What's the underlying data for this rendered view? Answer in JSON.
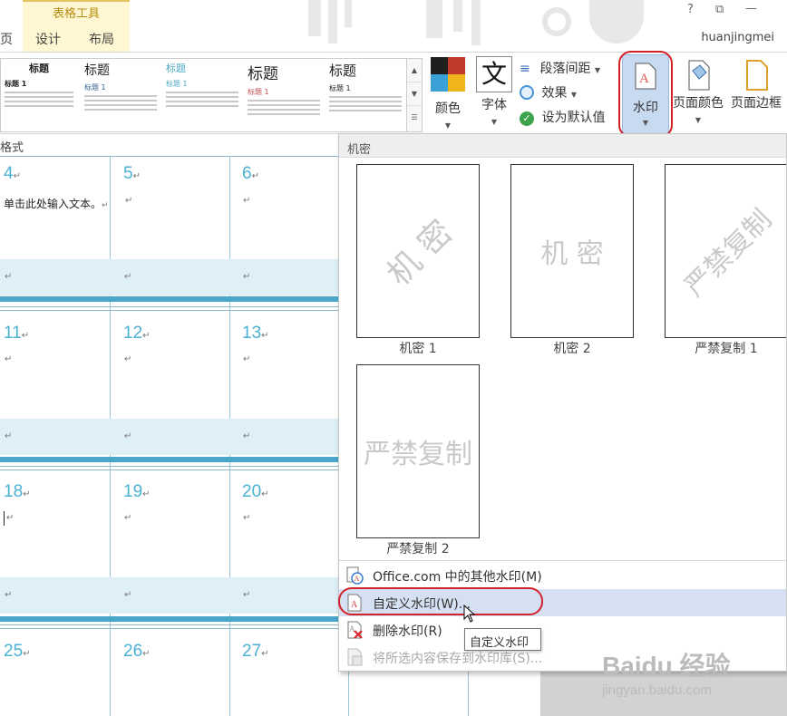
{
  "title_bar": {
    "context_group": "表格工具",
    "tabs": [
      "页",
      "设计",
      "布局"
    ],
    "help": "?",
    "restore": "⧉",
    "minimize": "—",
    "user": "huanjingmei"
  },
  "ribbon": {
    "gallery_styles": [
      {
        "title": "标题",
        "sub": "标题 1"
      },
      {
        "title": "标题",
        "sub": "标题 1"
      },
      {
        "title": "标题",
        "sub": "标题 1"
      },
      {
        "title": "标题",
        "sub": "标题 1"
      },
      {
        "title": "标题",
        "sub": "标题 1"
      }
    ],
    "colors_label": "颜色",
    "fonts_glyph": "文",
    "fonts_label": "字体",
    "paragraph_spacing": "段落间距",
    "effects": "效果",
    "set_default": "设为默认值",
    "watermark_label": "水印",
    "page_color_label": "页面颜色",
    "page_border_label": "页面边框"
  },
  "document": {
    "format_label": "格式",
    "placeholder_text": "单击此处输入文本。",
    "day_rows": [
      [
        "4",
        "5",
        "6"
      ],
      [
        "11",
        "12",
        "13"
      ],
      [
        "18",
        "19",
        "20"
      ],
      [
        "25",
        "26",
        "27"
      ]
    ]
  },
  "watermark_menu": {
    "section_title": "机密",
    "watermarks": [
      {
        "caption": "机密 1",
        "text": "机 密",
        "style": "diagonal"
      },
      {
        "caption": "机密 2",
        "text": "机 密",
        "style": "horizontal"
      },
      {
        "caption": "严禁复制 1",
        "text": "严禁复制",
        "style": "diagonal"
      },
      {
        "caption": "严禁复制 2",
        "text": "严禁复制",
        "style": "horizontal"
      }
    ],
    "items": [
      {
        "label": "Office.com 中的其他水印(M)",
        "enabled": true,
        "highlighted": false
      },
      {
        "label": "自定义水印(W)...",
        "enabled": true,
        "highlighted": true
      },
      {
        "label": "删除水印(R)",
        "enabled": true,
        "highlighted": false
      },
      {
        "label": "将所选内容保存到水印库(S)...",
        "enabled": false,
        "highlighted": false
      }
    ]
  },
  "tooltip": "自定义水印",
  "brand": {
    "logo_text": "Baidu 经验",
    "url": "jingyan.baidu.com"
  },
  "colors": {
    "accent_blue": "#4bb1d3",
    "highlight_circle": "#d2222a",
    "menu_highlight": "#d5e1f2"
  }
}
